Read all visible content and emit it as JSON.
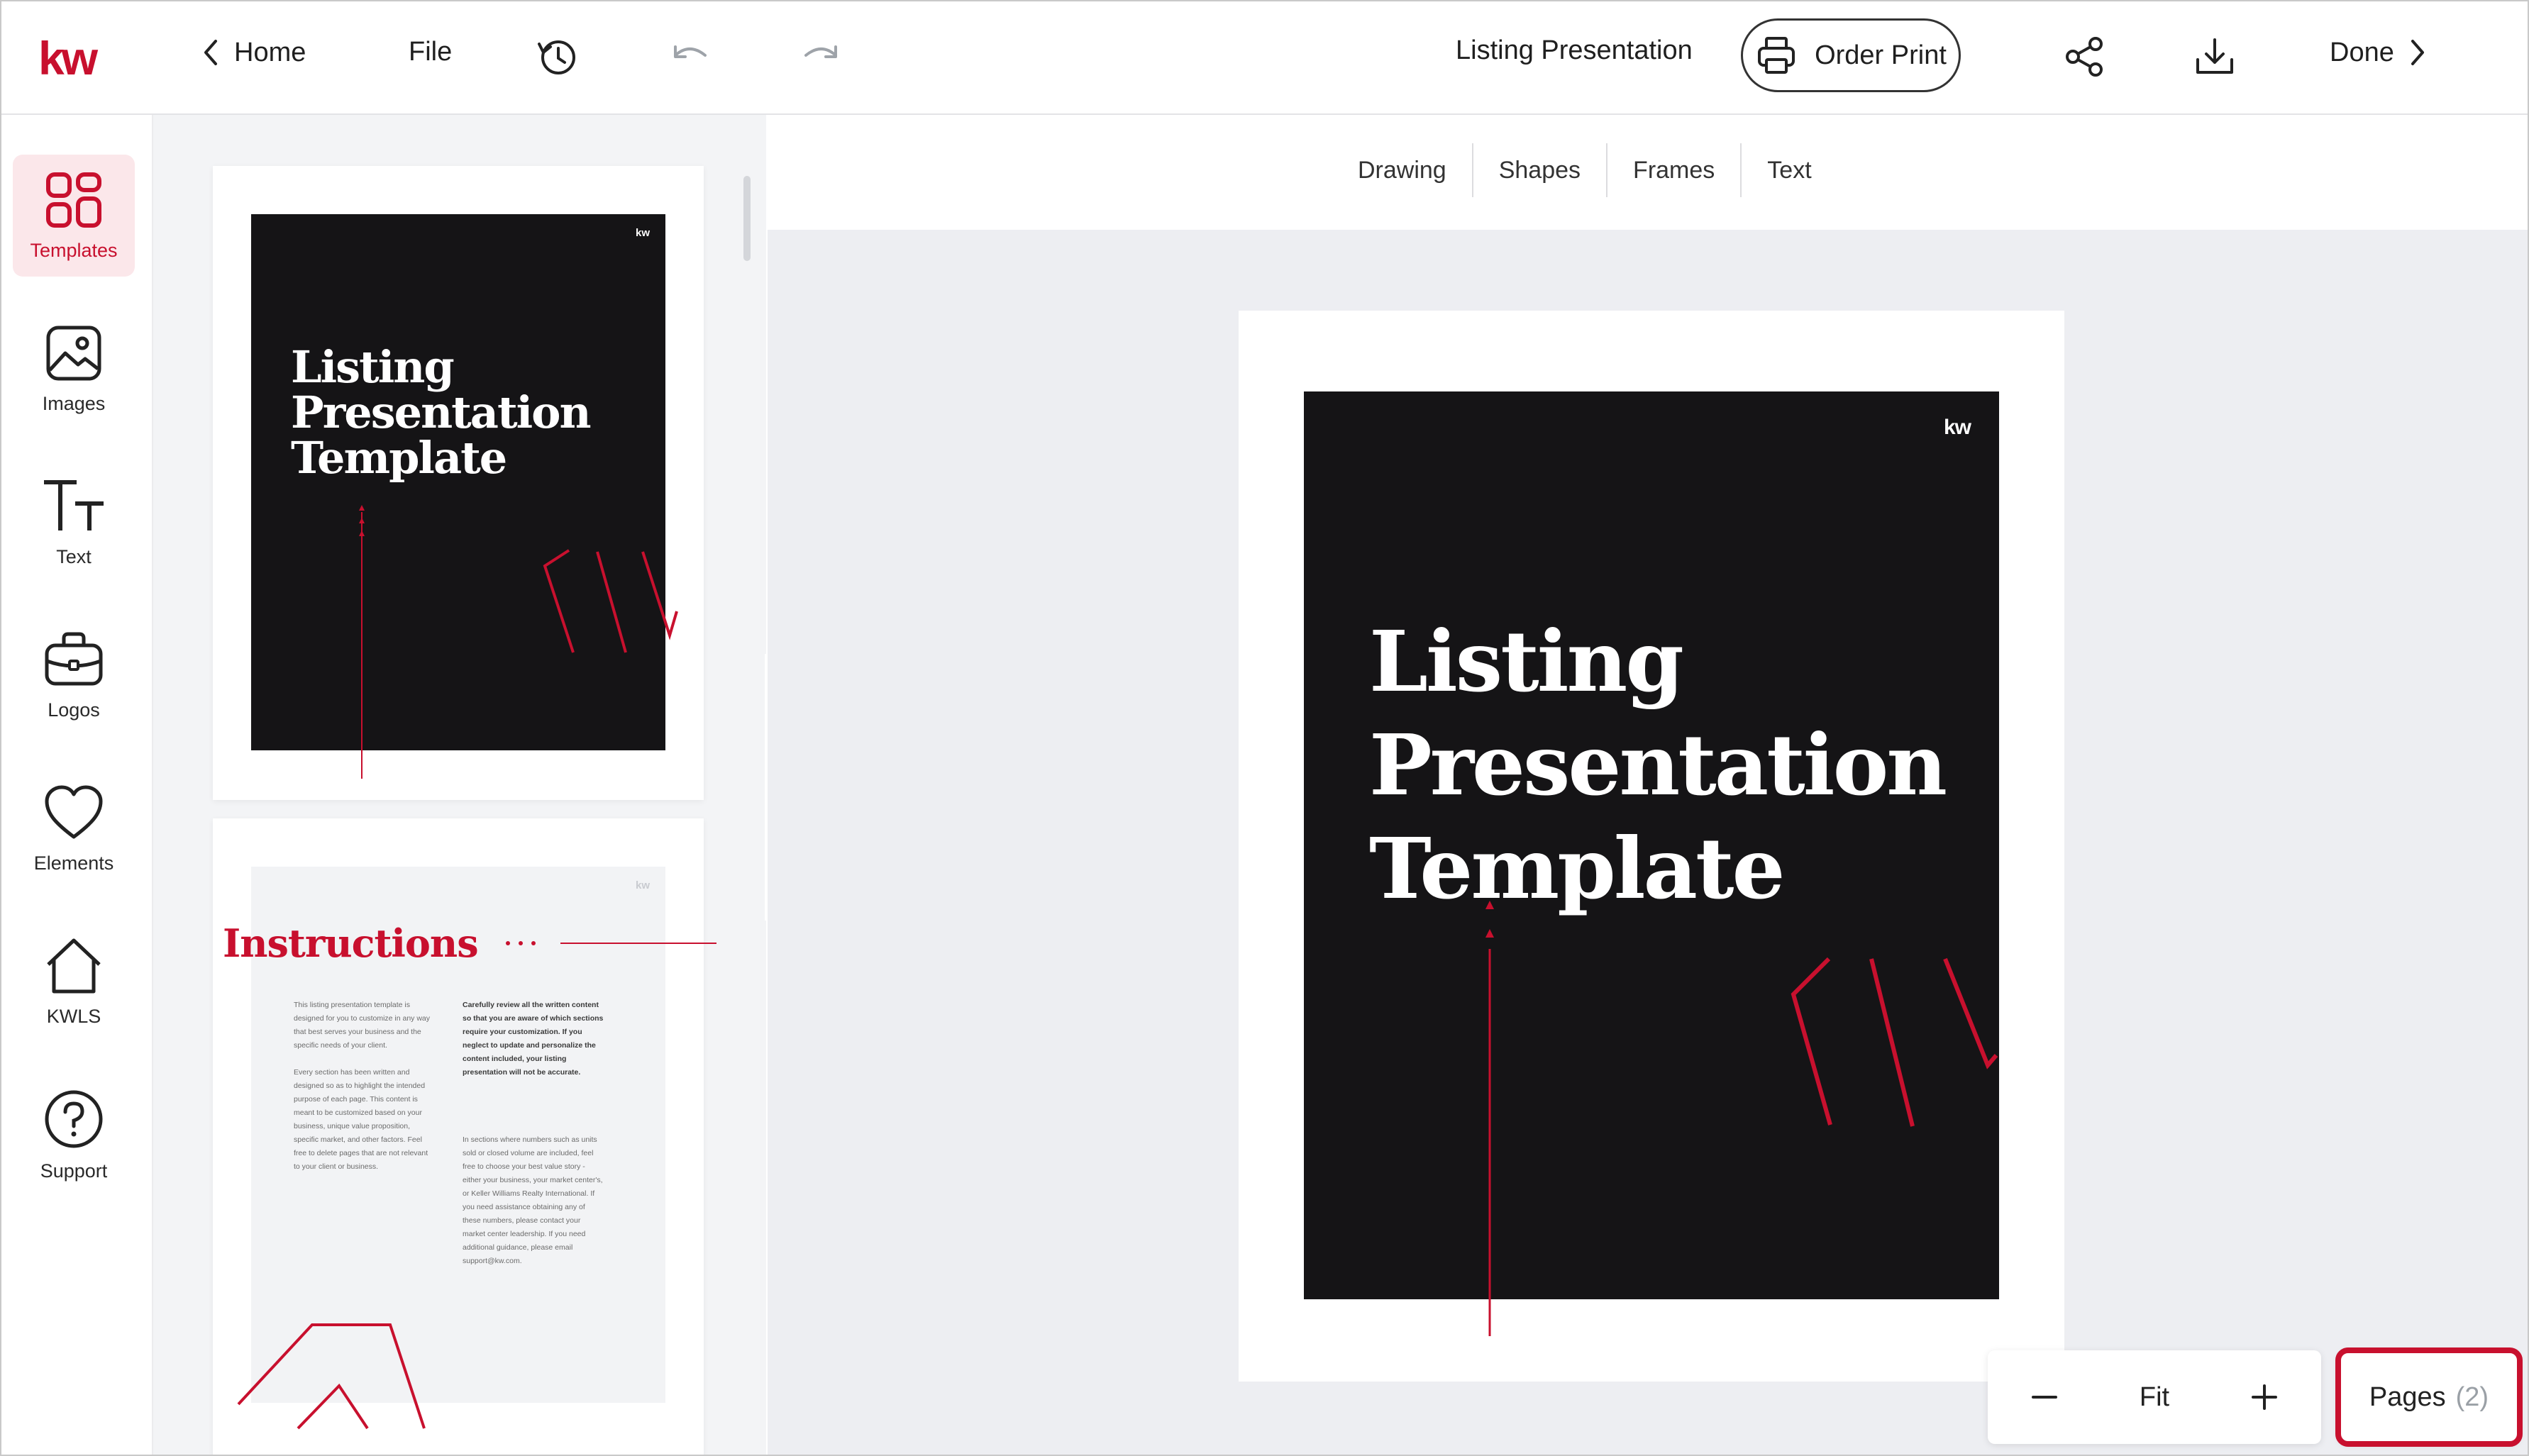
{
  "topbar": {
    "logo_text": "kw",
    "home_label": "Home",
    "file_label": "File",
    "document_title": "Listing Presentation",
    "order_print_label": "Order Print",
    "done_label": "Done"
  },
  "rail": {
    "items": [
      {
        "label": "Templates",
        "icon": "templates-icon",
        "active": true
      },
      {
        "label": "Images",
        "icon": "image-icon"
      },
      {
        "label": "Text",
        "icon": "text-icon"
      },
      {
        "label": "Logos",
        "icon": "briefcase-icon"
      },
      {
        "label": "Elements",
        "icon": "heart-icon"
      },
      {
        "label": "KWLS",
        "icon": "house-icon"
      },
      {
        "label": "Support",
        "icon": "help-icon"
      }
    ]
  },
  "subbar": {
    "tabs": [
      "Drawing",
      "Shapes",
      "Frames",
      "Text"
    ]
  },
  "thumbnails": {
    "page1": {
      "kw": "kw",
      "title_lines": [
        "Listing",
        "Presentation",
        "Template"
      ]
    },
    "page2": {
      "kw": "kw",
      "heading": "Instructions",
      "col1": "This listing presentation template is designed for you to customize in any way that best serves your business and the specific needs of your client.\n\nEvery section has been written and designed so as to highlight the intended purpose of each page. This content is meant to be customized based on your business, unique value proposition, specific market, and other factors. Feel free to delete pages that are not relevant to your client or business.",
      "col2_bold": "Carefully review all the written content so that you are aware of which sections require your customization. If you neglect to update and personalize the content included, your listing presentation will not be accurate.",
      "col2": "In sections where numbers such as units sold or closed volume are included, feel free to choose your best value story - either your business, your market center's, or Keller Williams Realty International. If you need assistance obtaining any of these numbers, please contact your market center leadership. If you need additional guidance, please email support@kw.com."
    }
  },
  "cover": {
    "kw": "kw",
    "title_lines": [
      "Listing",
      "Presentation",
      "Template"
    ]
  },
  "zoom": {
    "fit_label": "Fit"
  },
  "pages_button": {
    "label": "Pages",
    "count": "(2)"
  },
  "colors": {
    "accent": "#c8102e",
    "cover_bg": "#151416",
    "canvas_bg": "#edeef2"
  }
}
